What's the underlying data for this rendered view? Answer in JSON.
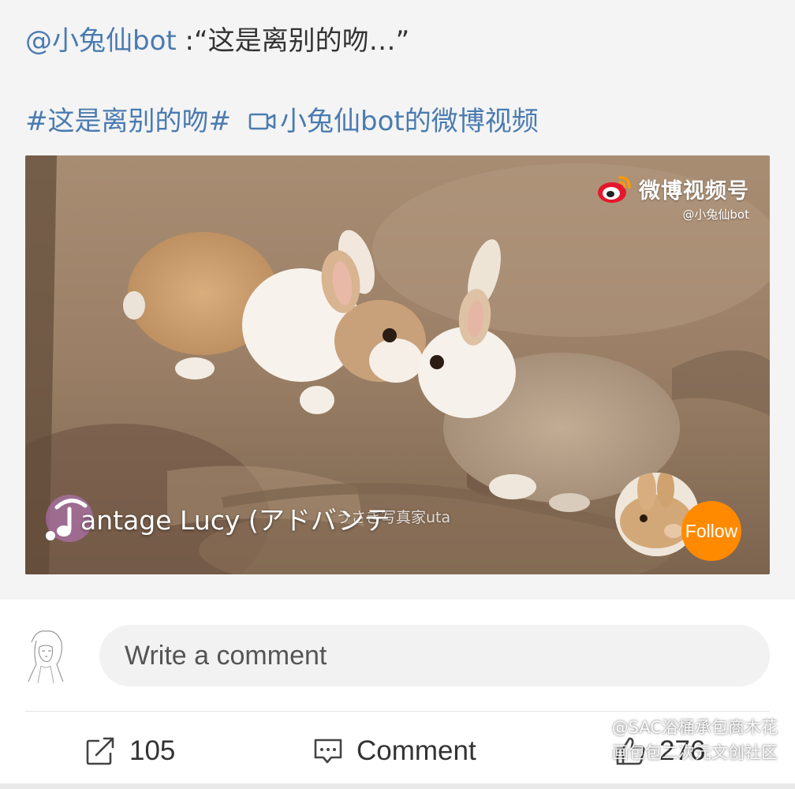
{
  "post": {
    "mention": "@小兔仙bot",
    "quote": ":“这是离别的吻…”",
    "hashtag": "#这是离别的吻#",
    "video_link": "小兔仙bot的微博视频"
  },
  "video": {
    "badge_title": "微博视频号",
    "badge_handle": "@小兔仙bot",
    "watermark": "うさぎ写真家uta",
    "music": "antage Lucy (アドバンテ",
    "follow_label": "Follow"
  },
  "comment_bar": {
    "placeholder": "Write a comment"
  },
  "actions": {
    "share_count": "105",
    "comment_label": "Comment",
    "like_count": "276"
  },
  "corner_watermark": {
    "line1": "@SAC浴桶承包商木花",
    "line2": "画包包二次元文创社区"
  },
  "colors": {
    "link": "#4a7bb0",
    "follow": "#ff8a00",
    "weibo_red": "#e6162d"
  }
}
